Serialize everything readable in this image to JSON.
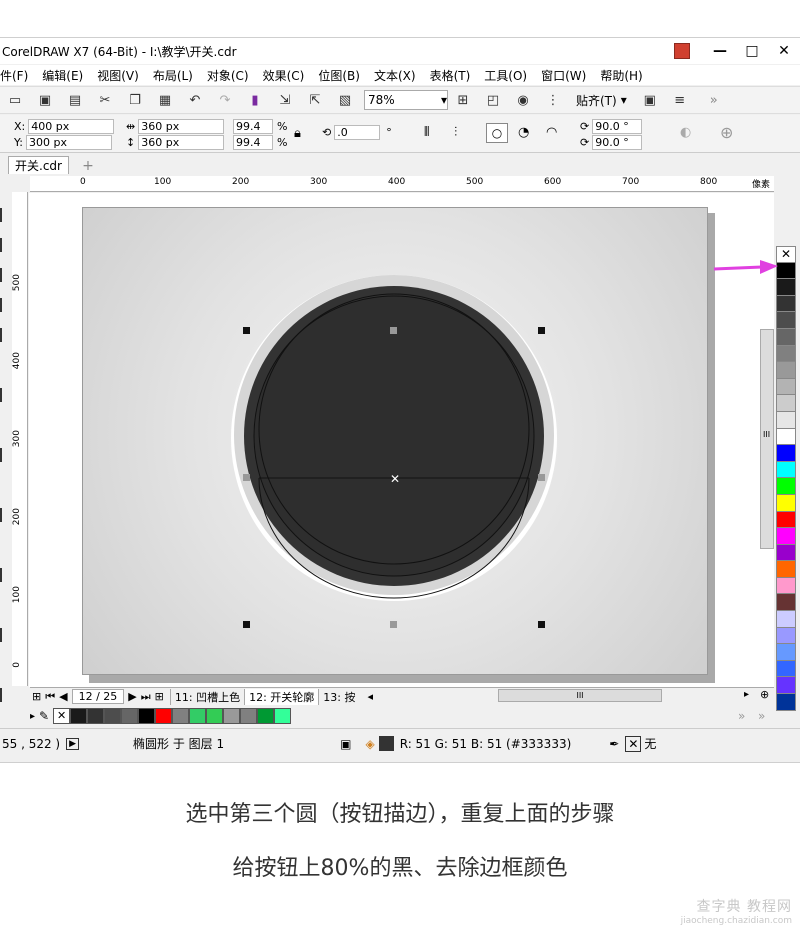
{
  "window": {
    "title": "CorelDRAW X7 (64-Bit) - I:\\教学\\开关.cdr",
    "controls": [
      "—",
      "□",
      "✕"
    ]
  },
  "menu": [
    "件(F)",
    "编辑(E)",
    "视图(V)",
    "布局(L)",
    "对象(C)",
    "效果(C)",
    "位图(B)",
    "文本(X)",
    "表格(T)",
    "工具(O)",
    "窗口(W)",
    "帮助(H)"
  ],
  "toolbar": {
    "zoom": "78%",
    "snap": "贴齐(T)"
  },
  "properties": {
    "x_label": "X:",
    "x_value": "400 px",
    "y_label": "Y:",
    "y_value": "300 px",
    "w_value": "360 px",
    "h_value": "360 px",
    "scale_w": "99.4",
    "scale_h": "99.4",
    "percent": "%",
    "rotation": ".0",
    "degree": "°",
    "angle1": "90.0 °",
    "angle2": "90.0 °"
  },
  "document_tab": "开关.cdr",
  "ruler": {
    "h_ticks": [
      "0",
      "100",
      "200",
      "300",
      "400",
      "500",
      "600",
      "700",
      "800"
    ],
    "h_unit": "像素",
    "v_ticks": [
      "500",
      "400",
      "300",
      "200",
      "100",
      "0"
    ]
  },
  "page_nav": {
    "page": "12 / 25",
    "tabs": [
      "11: 凹槽上色",
      "12: 开关轮廓",
      "13: 按"
    ]
  },
  "hscroll_label": "III",
  "vscroll_label": "III",
  "status": {
    "coords": "55 , 522 )",
    "object_info": "椭圆形 于 图层 1",
    "fill_info": "R: 51 G: 51 B: 51 (#333333)",
    "outline": "无"
  },
  "palette_vertical": [
    "#000000",
    "#1a1a1a",
    "#333333",
    "#4d4d4d",
    "#666666",
    "#808080",
    "#999999",
    "#b3b3b3",
    "#cccccc",
    "#e6e6e6",
    "#ffffff",
    "#0000ff",
    "#00ffff",
    "#00ff00",
    "#ffff00",
    "#ff0000",
    "#ff00ff",
    "#9900cc",
    "#ff6600",
    "#ff99cc",
    "#663333",
    "#ccccff",
    "#9999ff",
    "#6699ff",
    "#3366ff",
    "#6633ff",
    "#003399"
  ],
  "palette_horizontal": [
    "#1a1a1a",
    "#333333",
    "#4d4d4d",
    "#666666",
    "#000000",
    "#ff0000",
    "#808080",
    "#33cc66",
    "#33cc55",
    "#999999",
    "#808080",
    "#009933",
    "#33ff99"
  ],
  "colors": {
    "fill": "#333333",
    "arrow": "#e040e0"
  },
  "captions": [
    "选中第三个圆（按钮描边），重复上面的步骤",
    "给按钮上80%的黑、去除边框颜色"
  ],
  "watermark": {
    "line1": "查字典 教程网",
    "line2": "jiaocheng.chazidian.com"
  }
}
